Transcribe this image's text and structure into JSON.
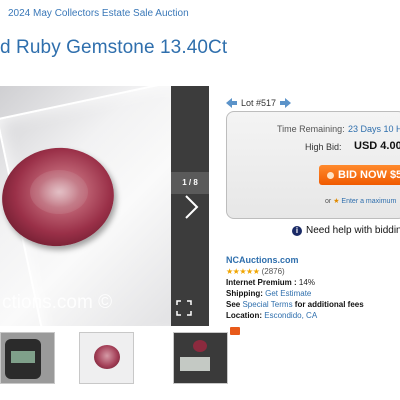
{
  "header": {
    "breadcrumb": "2024 May Collectors Estate Sale Auction",
    "title": "d Ruby Gemstone 13.40Ct"
  },
  "gallery": {
    "counter": "1 / 8",
    "watermark": "ctions.com ©"
  },
  "lot": {
    "label": "Lot #517"
  },
  "bid_box": {
    "time_label": "Time Remaining:",
    "time_value": "23 Days 10 H",
    "high_label": "High Bid:",
    "high_value": "USD 4.00",
    "bid_button": "BID NOW $5",
    "or_text": "or",
    "max_link": "Enter a maximum"
  },
  "help": {
    "text": "Need help with bidding"
  },
  "seller": {
    "name": "NCAuctions.com",
    "stars": "★★★★★",
    "rating_count": "(2876)",
    "premium_label": "Internet Premium :",
    "premium_value": "14%",
    "shipping_label": "Shipping:",
    "shipping_link": "Get Estimate",
    "see": "See",
    "terms_link": "Special Terms",
    "terms_suffix": "for additional fees",
    "location_label": "Location:",
    "location_value": "Escondido, CA"
  },
  "colors": {
    "link": "#2f6fad",
    "bid_button": "#f05a00",
    "stars": "#f0a500"
  }
}
